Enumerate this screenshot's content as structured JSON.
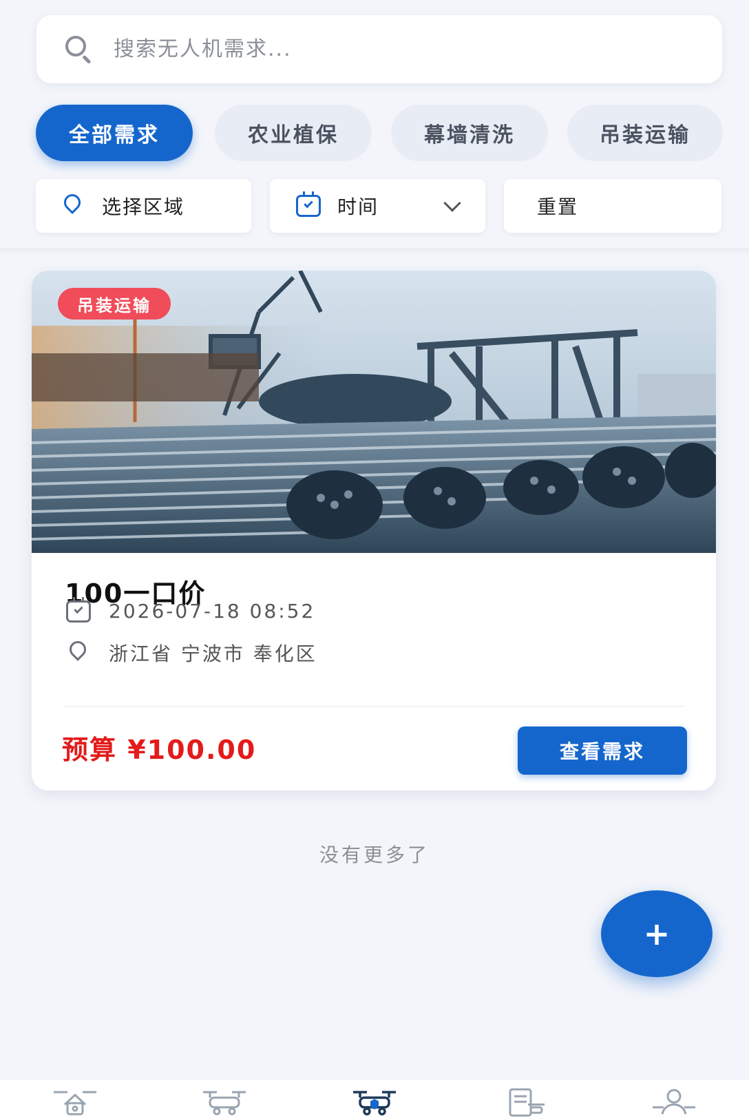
{
  "search": {
    "placeholder": "搜索无人机需求..."
  },
  "categories": [
    {
      "label": "全部需求",
      "active": true
    },
    {
      "label": "农业植保",
      "active": false
    },
    {
      "label": "幕墙清洗",
      "active": false
    },
    {
      "label": "吊装运输",
      "active": false
    }
  ],
  "filters": {
    "region_label": "选择区域",
    "time_label": "时间",
    "reset_label": "重置"
  },
  "card": {
    "badge": "吊装运输",
    "image_icon": "steel-rebar-photo",
    "title": "100一口价",
    "datetime": "2026-07-18 08:52",
    "location": "浙江省 宁波市 奉化区",
    "budget": "预算 ¥100.00",
    "view_button": "查看需求"
  },
  "list_end_text": "没有更多了",
  "fab_label": "+",
  "bottom_nav": {
    "items": [
      {
        "icon": "drone-home-icon"
      },
      {
        "icon": "drone-service-icon"
      },
      {
        "icon": "drone-demand-icon",
        "active": true
      },
      {
        "icon": "drone-document-icon"
      },
      {
        "icon": "drone-profile-icon"
      }
    ]
  },
  "colors": {
    "primary": "#1566cc",
    "badge": "#f04c5a",
    "price": "#e31b1b",
    "background": "#f3f5fa"
  }
}
